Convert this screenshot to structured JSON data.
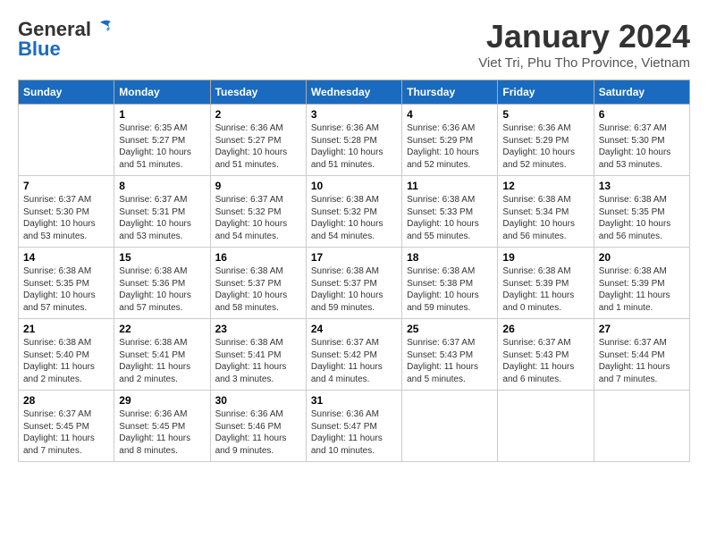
{
  "header": {
    "logo_general": "General",
    "logo_blue": "Blue",
    "month_title": "January 2024",
    "location": "Viet Tri, Phu Tho Province, Vietnam"
  },
  "days_of_week": [
    "Sunday",
    "Monday",
    "Tuesday",
    "Wednesday",
    "Thursday",
    "Friday",
    "Saturday"
  ],
  "weeks": [
    [
      {
        "day": "",
        "info": ""
      },
      {
        "day": "1",
        "info": "Sunrise: 6:35 AM\nSunset: 5:27 PM\nDaylight: 10 hours\nand 51 minutes."
      },
      {
        "day": "2",
        "info": "Sunrise: 6:36 AM\nSunset: 5:27 PM\nDaylight: 10 hours\nand 51 minutes."
      },
      {
        "day": "3",
        "info": "Sunrise: 6:36 AM\nSunset: 5:28 PM\nDaylight: 10 hours\nand 51 minutes."
      },
      {
        "day": "4",
        "info": "Sunrise: 6:36 AM\nSunset: 5:29 PM\nDaylight: 10 hours\nand 52 minutes."
      },
      {
        "day": "5",
        "info": "Sunrise: 6:36 AM\nSunset: 5:29 PM\nDaylight: 10 hours\nand 52 minutes."
      },
      {
        "day": "6",
        "info": "Sunrise: 6:37 AM\nSunset: 5:30 PM\nDaylight: 10 hours\nand 53 minutes."
      }
    ],
    [
      {
        "day": "7",
        "info": "Sunrise: 6:37 AM\nSunset: 5:30 PM\nDaylight: 10 hours\nand 53 minutes."
      },
      {
        "day": "8",
        "info": "Sunrise: 6:37 AM\nSunset: 5:31 PM\nDaylight: 10 hours\nand 53 minutes."
      },
      {
        "day": "9",
        "info": "Sunrise: 6:37 AM\nSunset: 5:32 PM\nDaylight: 10 hours\nand 54 minutes."
      },
      {
        "day": "10",
        "info": "Sunrise: 6:38 AM\nSunset: 5:32 PM\nDaylight: 10 hours\nand 54 minutes."
      },
      {
        "day": "11",
        "info": "Sunrise: 6:38 AM\nSunset: 5:33 PM\nDaylight: 10 hours\nand 55 minutes."
      },
      {
        "day": "12",
        "info": "Sunrise: 6:38 AM\nSunset: 5:34 PM\nDaylight: 10 hours\nand 56 minutes."
      },
      {
        "day": "13",
        "info": "Sunrise: 6:38 AM\nSunset: 5:35 PM\nDaylight: 10 hours\nand 56 minutes."
      }
    ],
    [
      {
        "day": "14",
        "info": "Sunrise: 6:38 AM\nSunset: 5:35 PM\nDaylight: 10 hours\nand 57 minutes."
      },
      {
        "day": "15",
        "info": "Sunrise: 6:38 AM\nSunset: 5:36 PM\nDaylight: 10 hours\nand 57 minutes."
      },
      {
        "day": "16",
        "info": "Sunrise: 6:38 AM\nSunset: 5:37 PM\nDaylight: 10 hours\nand 58 minutes."
      },
      {
        "day": "17",
        "info": "Sunrise: 6:38 AM\nSunset: 5:37 PM\nDaylight: 10 hours\nand 59 minutes."
      },
      {
        "day": "18",
        "info": "Sunrise: 6:38 AM\nSunset: 5:38 PM\nDaylight: 10 hours\nand 59 minutes."
      },
      {
        "day": "19",
        "info": "Sunrise: 6:38 AM\nSunset: 5:39 PM\nDaylight: 11 hours\nand 0 minutes."
      },
      {
        "day": "20",
        "info": "Sunrise: 6:38 AM\nSunset: 5:39 PM\nDaylight: 11 hours\nand 1 minute."
      }
    ],
    [
      {
        "day": "21",
        "info": "Sunrise: 6:38 AM\nSunset: 5:40 PM\nDaylight: 11 hours\nand 2 minutes."
      },
      {
        "day": "22",
        "info": "Sunrise: 6:38 AM\nSunset: 5:41 PM\nDaylight: 11 hours\nand 2 minutes."
      },
      {
        "day": "23",
        "info": "Sunrise: 6:38 AM\nSunset: 5:41 PM\nDaylight: 11 hours\nand 3 minutes."
      },
      {
        "day": "24",
        "info": "Sunrise: 6:37 AM\nSunset: 5:42 PM\nDaylight: 11 hours\nand 4 minutes."
      },
      {
        "day": "25",
        "info": "Sunrise: 6:37 AM\nSunset: 5:43 PM\nDaylight: 11 hours\nand 5 minutes."
      },
      {
        "day": "26",
        "info": "Sunrise: 6:37 AM\nSunset: 5:43 PM\nDaylight: 11 hours\nand 6 minutes."
      },
      {
        "day": "27",
        "info": "Sunrise: 6:37 AM\nSunset: 5:44 PM\nDaylight: 11 hours\nand 7 minutes."
      }
    ],
    [
      {
        "day": "28",
        "info": "Sunrise: 6:37 AM\nSunset: 5:45 PM\nDaylight: 11 hours\nand 7 minutes."
      },
      {
        "day": "29",
        "info": "Sunrise: 6:36 AM\nSunset: 5:45 PM\nDaylight: 11 hours\nand 8 minutes."
      },
      {
        "day": "30",
        "info": "Sunrise: 6:36 AM\nSunset: 5:46 PM\nDaylight: 11 hours\nand 9 minutes."
      },
      {
        "day": "31",
        "info": "Sunrise: 6:36 AM\nSunset: 5:47 PM\nDaylight: 11 hours\nand 10 minutes."
      },
      {
        "day": "",
        "info": ""
      },
      {
        "day": "",
        "info": ""
      },
      {
        "day": "",
        "info": ""
      }
    ]
  ]
}
